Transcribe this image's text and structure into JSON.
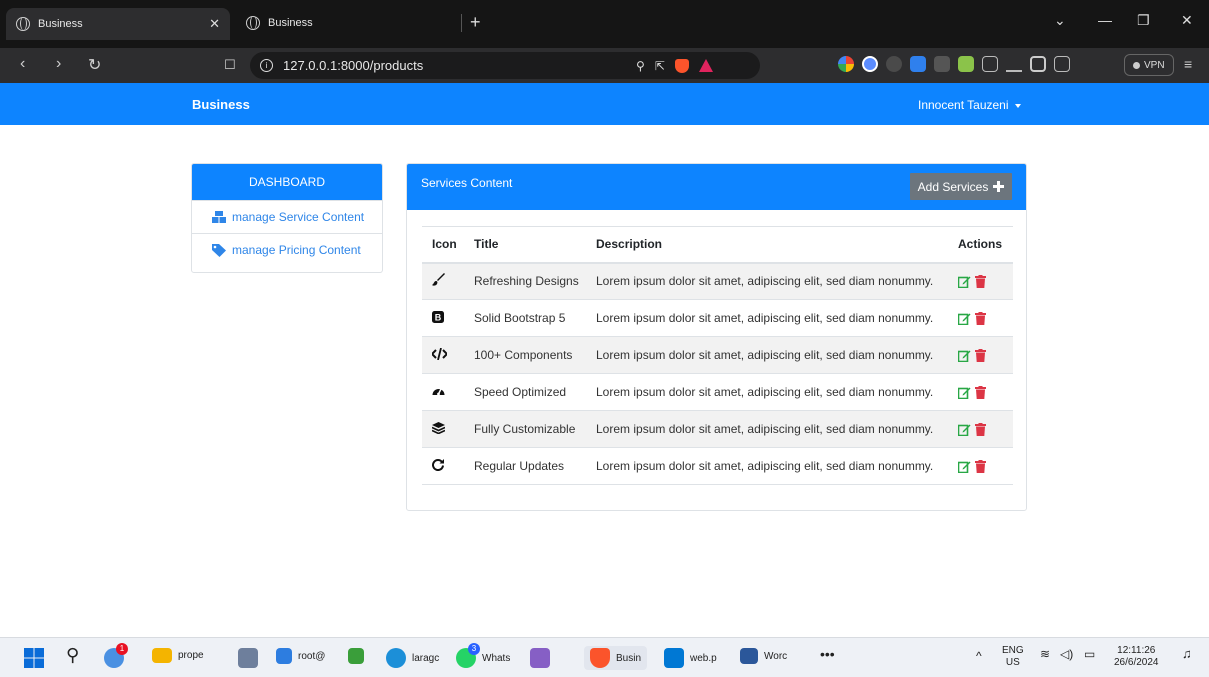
{
  "browser": {
    "tabs": [
      {
        "title": "Business",
        "active": true
      },
      {
        "title": "Business",
        "active": false
      }
    ],
    "url": "127.0.0.1:8000/products",
    "vpn_label": "VPN"
  },
  "header": {
    "brand": "Business",
    "user_name": "Innocent Tauzeni"
  },
  "sidebar": {
    "title": "DASHBOARD",
    "items": [
      {
        "label": "manage Service Content",
        "icon": "boxes-icon"
      },
      {
        "label": "manage Pricing Content",
        "icon": "tag-icon"
      }
    ]
  },
  "services": {
    "card_title": "Services Content",
    "add_button": "Add Services",
    "columns": [
      "Icon",
      "Title",
      "Description",
      "Actions"
    ],
    "rows": [
      {
        "icon": "brush-icon",
        "title": "Refreshing Designs",
        "description": "Lorem ipsum dolor sit amet, adipiscing elit, sed diam nonummy."
      },
      {
        "icon": "bootstrap-icon",
        "title": "Solid Bootstrap 5",
        "description": "Lorem ipsum dolor sit amet, adipiscing elit, sed diam nonummy."
      },
      {
        "icon": "code-icon",
        "title": "100+ Components",
        "description": "Lorem ipsum dolor sit amet, adipiscing elit, sed diam nonummy."
      },
      {
        "icon": "speedometer-icon",
        "title": "Speed Optimized",
        "description": "Lorem ipsum dolor sit amet, adipiscing elit, sed diam nonummy."
      },
      {
        "icon": "layers-icon",
        "title": "Fully Customizable",
        "description": "Lorem ipsum dolor sit amet, adipiscing elit, sed diam nonummy."
      },
      {
        "icon": "refresh-icon",
        "title": "Regular Updates",
        "description": "Lorem ipsum dolor sit amet, adipiscing elit, sed diam nonummy."
      }
    ]
  },
  "taskbar": {
    "apps": [
      {
        "label": "prope"
      },
      {
        "label": "root@"
      },
      {
        "label": "laragc"
      },
      {
        "label": "Whats"
      },
      {
        "label": "Busin"
      },
      {
        "label": "web.p"
      },
      {
        "label": "Worc"
      }
    ],
    "whatsapp_badge": "3",
    "notification_badge": "1",
    "language": "ENG",
    "region": "US",
    "time": "12:11:26",
    "date": "26/6/2024"
  },
  "colors": {
    "primary": "#0d84ff",
    "secondary_button": "#6c757d",
    "edit_icon": "#28a745",
    "delete_icon": "#dc3545"
  }
}
